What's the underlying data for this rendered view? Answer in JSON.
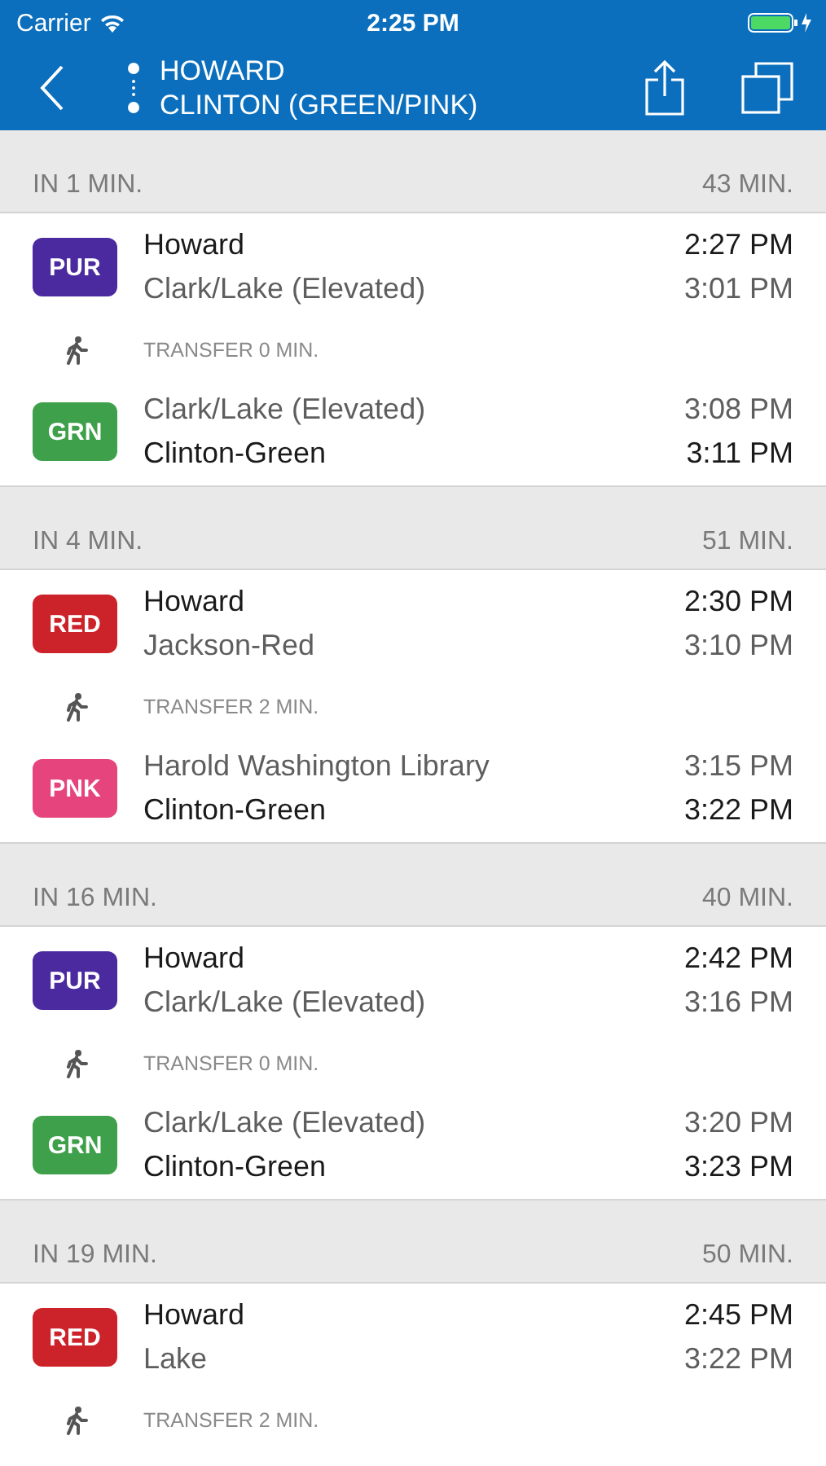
{
  "status_bar": {
    "carrier": "Carrier",
    "time": "2:25 PM"
  },
  "nav": {
    "origin": "HOWARD",
    "destination": "CLINTON (GREEN/PINK)"
  },
  "trips": [
    {
      "departs_in": "IN 1 MIN.",
      "duration": "43 MIN.",
      "segments": [
        {
          "kind": "leg",
          "line": "PUR",
          "color": "#4b2aa0",
          "stops": [
            {
              "name": "Howard",
              "time": "2:27 PM",
              "highlighted": true
            },
            {
              "name": "Clark/Lake (Elevated)",
              "time": "3:01 PM",
              "highlighted": false
            }
          ]
        },
        {
          "kind": "transfer",
          "text": "TRANSFER 0 MIN."
        },
        {
          "kind": "leg",
          "line": "GRN",
          "color": "#3ea04a",
          "stops": [
            {
              "name": "Clark/Lake (Elevated)",
              "time": "3:08 PM",
              "highlighted": false
            },
            {
              "name": "Clinton-Green",
              "time": "3:11 PM",
              "highlighted": true
            }
          ]
        }
      ]
    },
    {
      "departs_in": "IN 4 MIN.",
      "duration": "51 MIN.",
      "segments": [
        {
          "kind": "leg",
          "line": "RED",
          "color": "#cc2229",
          "stops": [
            {
              "name": "Howard",
              "time": "2:30 PM",
              "highlighted": true
            },
            {
              "name": "Jackson-Red",
              "time": "3:10 PM",
              "highlighted": false
            }
          ]
        },
        {
          "kind": "transfer",
          "text": "TRANSFER 2 MIN."
        },
        {
          "kind": "leg",
          "line": "PNK",
          "color": "#e6447c",
          "stops": [
            {
              "name": "Harold Washington Library",
              "time": "3:15 PM",
              "highlighted": false
            },
            {
              "name": "Clinton-Green",
              "time": "3:22 PM",
              "highlighted": true
            }
          ]
        }
      ]
    },
    {
      "departs_in": "IN 16 MIN.",
      "duration": "40 MIN.",
      "segments": [
        {
          "kind": "leg",
          "line": "PUR",
          "color": "#4b2aa0",
          "stops": [
            {
              "name": "Howard",
              "time": "2:42 PM",
              "highlighted": true
            },
            {
              "name": "Clark/Lake (Elevated)",
              "time": "3:16 PM",
              "highlighted": false
            }
          ]
        },
        {
          "kind": "transfer",
          "text": "TRANSFER 0 MIN."
        },
        {
          "kind": "leg",
          "line": "GRN",
          "color": "#3ea04a",
          "stops": [
            {
              "name": "Clark/Lake (Elevated)",
              "time": "3:20 PM",
              "highlighted": false
            },
            {
              "name": "Clinton-Green",
              "time": "3:23 PM",
              "highlighted": true
            }
          ]
        }
      ]
    },
    {
      "departs_in": "IN 19 MIN.",
      "duration": "50 MIN.",
      "segments": [
        {
          "kind": "leg",
          "line": "RED",
          "color": "#cc2229",
          "stops": [
            {
              "name": "Howard",
              "time": "2:45 PM",
              "highlighted": true
            },
            {
              "name": "Lake",
              "time": "3:22 PM",
              "highlighted": false
            }
          ]
        },
        {
          "kind": "transfer",
          "text": "TRANSFER 2 MIN."
        }
      ]
    }
  ]
}
